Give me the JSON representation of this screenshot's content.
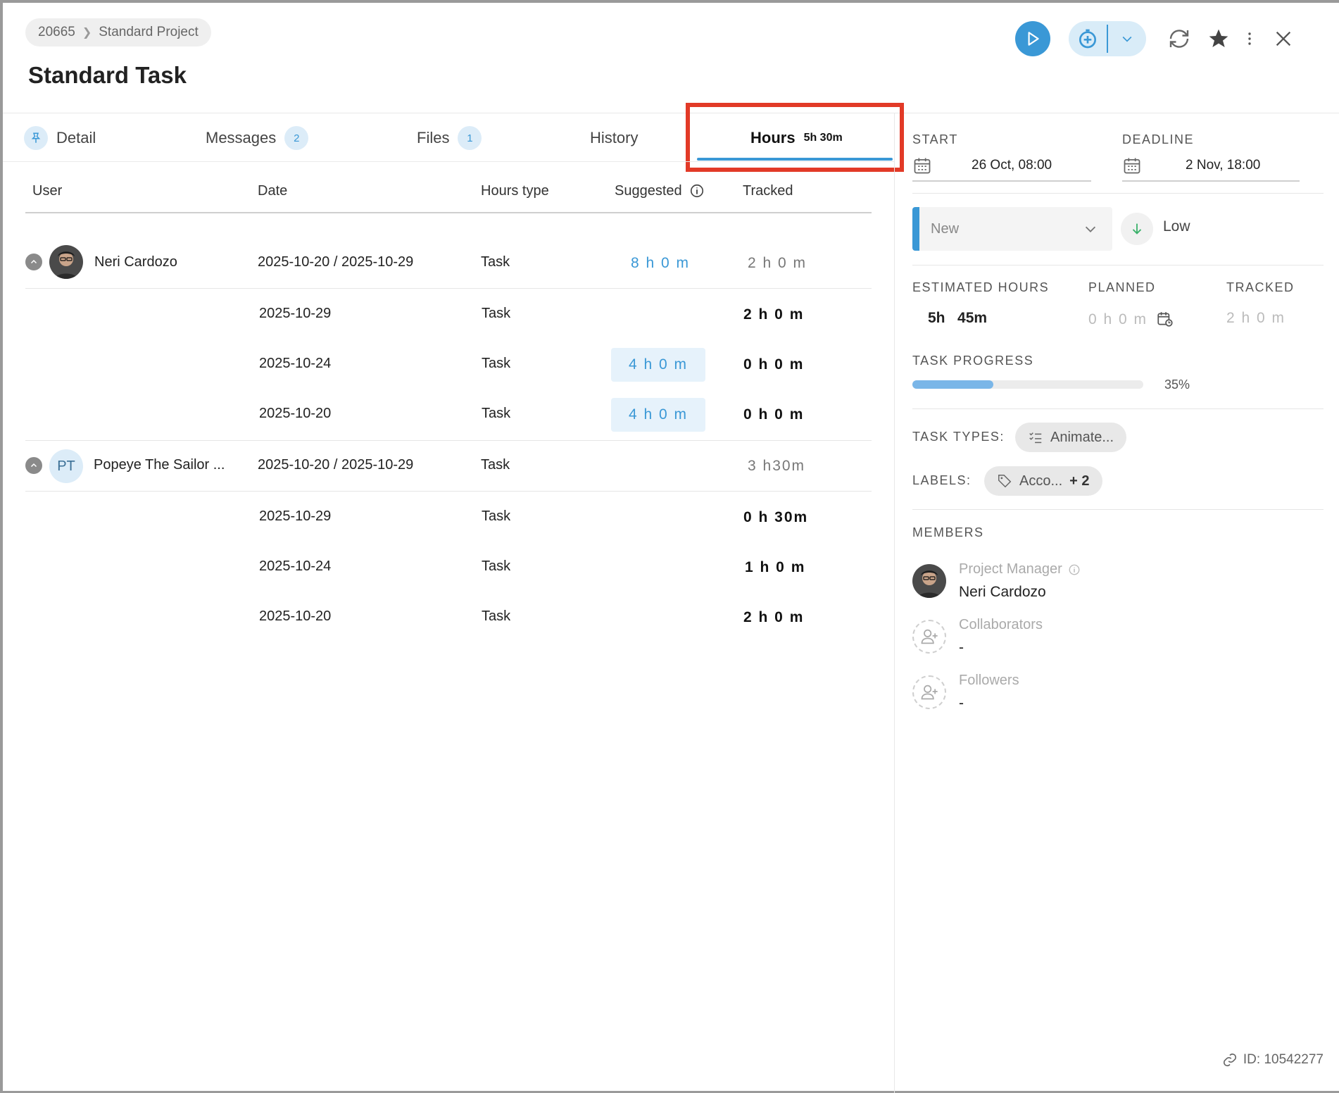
{
  "header": {
    "breadcrumb": {
      "project_id": "20665",
      "project_name": "Standard Project"
    },
    "title": "Standard Task",
    "accent_color": "#3a98d6"
  },
  "tabs": [
    {
      "label": "Detail",
      "icon": "pin-icon"
    },
    {
      "label": "Messages",
      "badge": "2"
    },
    {
      "label": "Files",
      "badge": "1"
    },
    {
      "label": "History"
    },
    {
      "label": "Hours",
      "suffix": "5h 30m",
      "active": true
    }
  ],
  "table": {
    "columns": {
      "user": "User",
      "date": "Date",
      "hours_type": "Hours type",
      "suggested": "Suggested",
      "tracked": "Tracked"
    },
    "groups": [
      {
        "user": "Neri Cardozo",
        "range": "2025-10-20 / 2025-10-29",
        "type": "Task",
        "suggested": "8 h 0 m",
        "tracked": "2 h 0 m",
        "rows": [
          {
            "date": "2025-10-29",
            "type": "Task",
            "suggested": "",
            "tracked": "2 h  0 m"
          },
          {
            "date": "2025-10-24",
            "type": "Task",
            "suggested": "4 h  0 m",
            "tracked": "0 h  0 m"
          },
          {
            "date": "2025-10-20",
            "type": "Task",
            "suggested": "4 h  0 m",
            "tracked": "0 h  0 m"
          }
        ]
      },
      {
        "user": "Popeye The Sailor ...",
        "initials": "PT",
        "range": "2025-10-20 / 2025-10-29",
        "type": "Task",
        "suggested": "",
        "tracked": "3 h30m",
        "rows": [
          {
            "date": "2025-10-29",
            "type": "Task",
            "tracked": "0 h  30m"
          },
          {
            "date": "2025-10-24",
            "type": "Task",
            "tracked": "1 h  0 m"
          },
          {
            "date": "2025-10-20",
            "type": "Task",
            "tracked": "2 h  0 m"
          }
        ]
      }
    ]
  },
  "side": {
    "start_label": "START",
    "start_value": "26 Oct, 08:00",
    "deadline_label": "DEADLINE",
    "deadline_value": "2 Nov, 18:00",
    "status": "New",
    "priority": "Low",
    "estimated_label": "ESTIMATED HOURS",
    "estimated_value": "5h   45m",
    "planned_label": "PLANNED",
    "planned_value": "0 h 0 m",
    "tracked_label": "TRACKED",
    "tracked_value": "2 h 0 m",
    "progress_label": "TASK PROGRESS",
    "progress_percent": 35,
    "progress_text": "35%",
    "task_types_label": "TASK TYPES:",
    "task_type_chip": "Animate...",
    "labels_label": "LABELS:",
    "label_chip": "Acco...",
    "label_more": "+ 2",
    "members_label": "MEMBERS",
    "members": [
      {
        "role": "Project Manager",
        "name": "Neri Cardozo"
      },
      {
        "role": "Collaborators",
        "name": "-"
      },
      {
        "role": "Followers",
        "name": "-"
      }
    ],
    "id_text": "ID: 10542277"
  }
}
